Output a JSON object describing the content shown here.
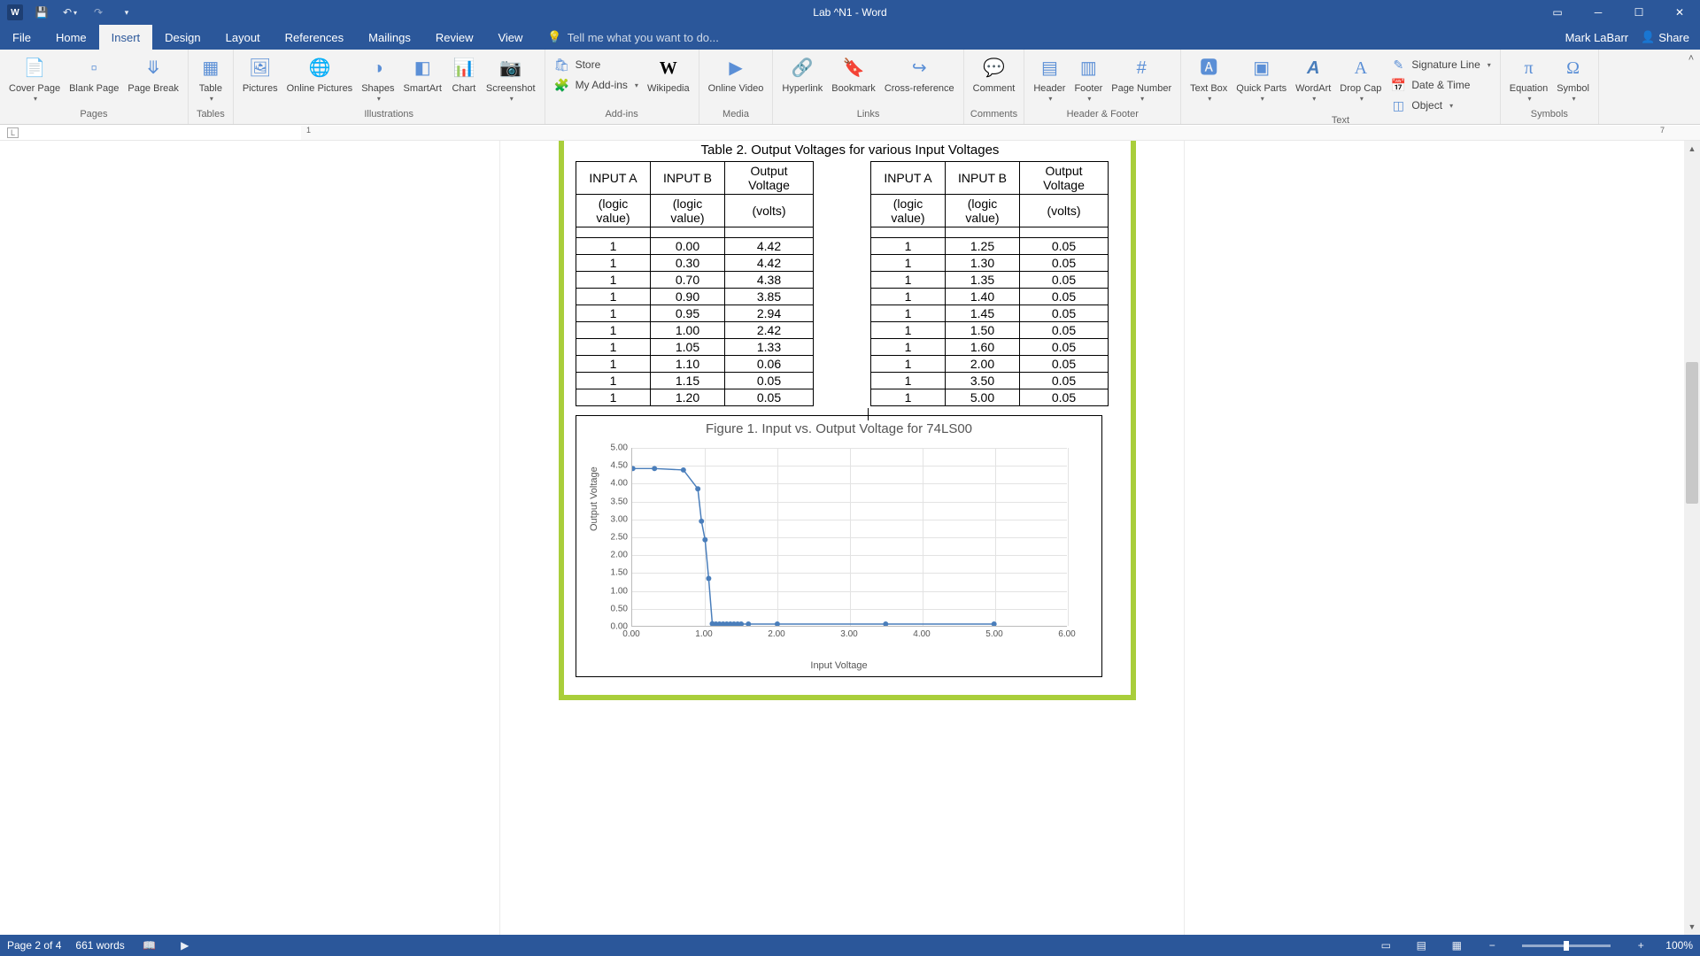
{
  "titlebar": {
    "doc_title": "Lab ^N1 - Word"
  },
  "menutabs": [
    "File",
    "Home",
    "Insert",
    "Design",
    "Layout",
    "References",
    "Mailings",
    "Review",
    "View"
  ],
  "activeTab": "Insert",
  "tellme_placeholder": "Tell me what you want to do...",
  "user_name": "Mark LaBarr",
  "share_label": "Share",
  "ribbon": {
    "pages": {
      "label": "Pages",
      "cover": "Cover Page",
      "blank": "Blank Page",
      "break": "Page Break"
    },
    "tables": {
      "label": "Tables",
      "table": "Table"
    },
    "illus": {
      "label": "Illustrations",
      "pictures": "Pictures",
      "online": "Online Pictures",
      "shapes": "Shapes",
      "smartart": "SmartArt",
      "chart": "Chart",
      "screenshot": "Screenshot"
    },
    "addins": {
      "label": "Add-ins",
      "store": "Store",
      "myaddins": "My Add-ins",
      "wikipedia": "Wikipedia"
    },
    "media": {
      "label": "Media",
      "video": "Online Video"
    },
    "links": {
      "label": "Links",
      "hyperlink": "Hyperlink",
      "bookmark": "Bookmark",
      "cross": "Cross-reference"
    },
    "comments": {
      "label": "Comments",
      "comment": "Comment"
    },
    "hf": {
      "label": "Header & Footer",
      "header": "Header",
      "footer": "Footer",
      "pagenum": "Page Number"
    },
    "text": {
      "label": "Text",
      "textbox": "Text Box",
      "quick": "Quick Parts",
      "wordart": "WordArt",
      "dropcap": "Drop Cap",
      "sig": "Signature Line",
      "dt": "Date & Time",
      "obj": "Object"
    },
    "symbols": {
      "label": "Symbols",
      "eq": "Equation",
      "sym": "Symbol"
    }
  },
  "doc": {
    "table_title": "Table 2. Output Voltages for various Input Voltages",
    "headers": {
      "a": "INPUT A",
      "b": "INPUT B",
      "ov": "Output Voltage",
      "asub": "(logic value)",
      "bsub": "(logic value)",
      "ovsub": "(volts)"
    },
    "left_rows": [
      [
        "1",
        "0.00",
        "4.42"
      ],
      [
        "1",
        "0.30",
        "4.42"
      ],
      [
        "1",
        "0.70",
        "4.38"
      ],
      [
        "1",
        "0.90",
        "3.85"
      ],
      [
        "1",
        "0.95",
        "2.94"
      ],
      [
        "1",
        "1.00",
        "2.42"
      ],
      [
        "1",
        "1.05",
        "1.33"
      ],
      [
        "1",
        "1.10",
        "0.06"
      ],
      [
        "1",
        "1.15",
        "0.05"
      ],
      [
        "1",
        "1.20",
        "0.05"
      ]
    ],
    "right_rows": [
      [
        "1",
        "1.25",
        "0.05"
      ],
      [
        "1",
        "1.30",
        "0.05"
      ],
      [
        "1",
        "1.35",
        "0.05"
      ],
      [
        "1",
        "1.40",
        "0.05"
      ],
      [
        "1",
        "1.45",
        "0.05"
      ],
      [
        "1",
        "1.50",
        "0.05"
      ],
      [
        "1",
        "1.60",
        "0.05"
      ],
      [
        "1",
        "2.00",
        "0.05"
      ],
      [
        "1",
        "3.50",
        "0.05"
      ],
      [
        "1",
        "5.00",
        "0.05"
      ]
    ]
  },
  "chart_data": {
    "type": "line",
    "title": "Figure 1. Input vs. Output Voltage for 74LS00",
    "xlabel": "Input Voltage",
    "ylabel": "Output Voltage",
    "xlim": [
      0,
      6
    ],
    "ylim": [
      0,
      5
    ],
    "y_ticks": [
      "0.00",
      "0.50",
      "1.00",
      "1.50",
      "2.00",
      "2.50",
      "3.00",
      "3.50",
      "4.00",
      "4.50",
      "5.00"
    ],
    "x_ticks": [
      "0.00",
      "1.00",
      "2.00",
      "3.00",
      "4.00",
      "5.00",
      "6.00"
    ],
    "x": [
      0.0,
      0.3,
      0.7,
      0.9,
      0.95,
      1.0,
      1.05,
      1.1,
      1.15,
      1.2,
      1.25,
      1.3,
      1.35,
      1.4,
      1.45,
      1.5,
      1.6,
      2.0,
      3.5,
      5.0
    ],
    "values": [
      4.42,
      4.42,
      4.38,
      3.85,
      2.94,
      2.42,
      1.33,
      0.06,
      0.05,
      0.05,
      0.05,
      0.05,
      0.05,
      0.05,
      0.05,
      0.05,
      0.05,
      0.05,
      0.05,
      0.05
    ]
  },
  "status": {
    "page": "Page 2 of 4",
    "words": "661 words",
    "zoom": "100%"
  }
}
